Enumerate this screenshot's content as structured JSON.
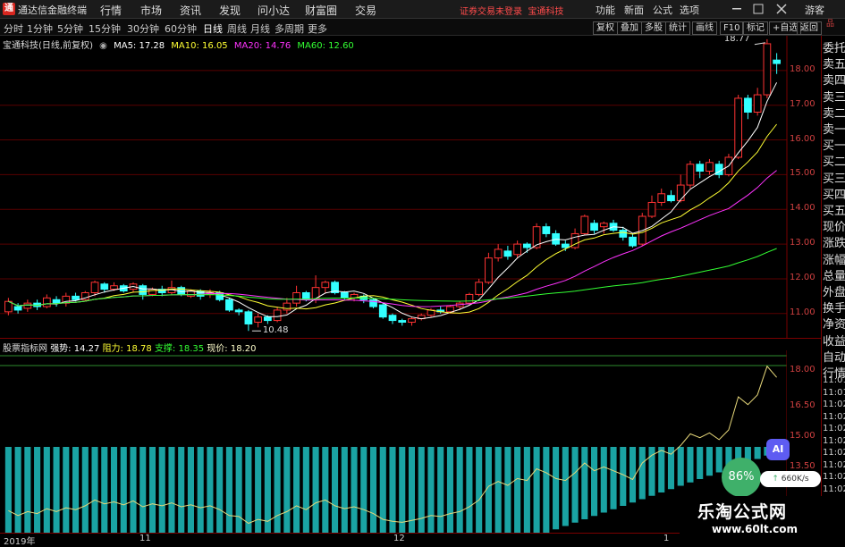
{
  "app": {
    "title": "通达信金融终端",
    "logo_char": "通"
  },
  "menu": [
    "行情",
    "市场",
    "资讯",
    "发现",
    "问小达",
    "财富圈",
    "交易"
  ],
  "notice": "证券交易未登录",
  "stock_name": "宝通科技",
  "right_menu": [
    "功能",
    "新面",
    "公式",
    "选项"
  ],
  "guest": "游客",
  "periods": [
    "分时",
    "1分钟",
    "5分钟",
    "15分钟",
    "30分钟",
    "60分钟",
    "日线",
    "周线",
    "月线",
    "多周期",
    "更多"
  ],
  "active_period": "日线",
  "toolbar_buttons": [
    "复权",
    "叠加",
    "多股",
    "统计",
    "画线",
    "F10",
    "标记",
    "+自选",
    "返回"
  ],
  "info": {
    "title": "宝通科技(日线,前复权)",
    "ma5": "MA5: 17.28",
    "ma10": "MA10: 16.05",
    "ma20": "MA20: 14.76",
    "ma60": "MA60: 12.60"
  },
  "colors": {
    "ma5": "#ffffff",
    "ma10": "#ffff33",
    "ma20": "#ff33ff",
    "ma60": "#33ff33",
    "up": "#ff3333",
    "down": "#33ffff",
    "background": "#000000"
  },
  "price_axis": [
    "18.00",
    "17.00",
    "16.00",
    "15.00",
    "14.00",
    "13.00",
    "12.00",
    "11.00"
  ],
  "annotations": {
    "high": "18.77",
    "low": "10.48"
  },
  "right_panel": [
    "委托",
    "卖五",
    "卖四",
    "卖三",
    "卖二",
    "卖一",
    "买一",
    "买二",
    "买三",
    "买四",
    "买五",
    "现价",
    "涨跌",
    "涨幅",
    "总量",
    "外盘",
    "换手",
    "净资",
    "收益",
    "自动",
    "行情"
  ],
  "right_panel_top": "品",
  "sub_indicator": {
    "name": "股票指标网",
    "pressure": "强势: 14.27",
    "resistance": "阻力: 18.78",
    "support": "支撑: 18.35",
    "price": "现价: 18.20"
  },
  "sub_axis": [
    "18.00",
    "16.50",
    "15.00",
    "13.50"
  ],
  "time_labels": [
    "11:01",
    "11:01",
    "11:02",
    "11:02",
    "11:02",
    "11:02",
    "11:02",
    "11:02",
    "11:02",
    "11:02",
    "11:02"
  ],
  "date_axis": [
    "2019年",
    "11",
    "12",
    "1"
  ],
  "perf": "86%",
  "net_speed": "660K/s",
  "ai_label": "AI",
  "watermark": {
    "line1": "乐淘公式网",
    "line2": "www.60lt.com"
  },
  "chart_data": {
    "type": "candlestick",
    "ylim": [
      10.3,
      19.0
    ],
    "candles": [
      [
        11.05,
        11.35,
        11.45,
        10.95
      ],
      [
        11.2,
        11.1,
        11.3,
        11.0
      ],
      [
        11.15,
        11.3,
        11.4,
        11.05
      ],
      [
        11.3,
        11.2,
        11.4,
        11.1
      ],
      [
        11.2,
        11.45,
        11.55,
        11.15
      ],
      [
        11.4,
        11.3,
        11.5,
        11.2
      ],
      [
        11.3,
        11.5,
        11.6,
        11.2
      ],
      [
        11.5,
        11.4,
        11.6,
        11.35
      ],
      [
        11.4,
        11.6,
        11.65,
        11.35
      ],
      [
        11.6,
        11.9,
        11.95,
        11.5
      ],
      [
        11.85,
        11.7,
        11.9,
        11.6
      ],
      [
        11.7,
        11.8,
        11.9,
        11.65
      ],
      [
        11.8,
        11.65,
        11.85,
        11.6
      ],
      [
        11.7,
        11.85,
        11.9,
        11.6
      ],
      [
        11.8,
        11.55,
        11.85,
        11.4
      ],
      [
        11.55,
        11.7,
        11.75,
        11.5
      ],
      [
        11.7,
        11.6,
        11.8,
        11.5
      ],
      [
        11.6,
        11.75,
        11.95,
        11.55
      ],
      [
        11.75,
        11.55,
        11.8,
        11.5
      ],
      [
        11.5,
        11.65,
        11.7,
        11.45
      ],
      [
        11.65,
        11.5,
        11.7,
        11.4
      ],
      [
        11.55,
        11.6,
        11.7,
        11.45
      ],
      [
        11.6,
        11.4,
        11.65,
        11.35
      ],
      [
        11.4,
        11.1,
        11.45,
        11.05
      ],
      [
        11.1,
        11.05,
        11.15,
        10.95
      ],
      [
        11.05,
        10.7,
        11.1,
        10.5
      ],
      [
        10.75,
        10.9,
        11.0,
        10.6
      ],
      [
        10.9,
        10.8,
        10.95,
        10.7
      ],
      [
        10.8,
        11.1,
        11.2,
        10.75
      ],
      [
        11.1,
        11.3,
        11.45,
        11.0
      ],
      [
        11.3,
        11.6,
        11.8,
        11.2
      ],
      [
        11.6,
        11.4,
        11.65,
        11.35
      ],
      [
        11.4,
        11.75,
        12.1,
        11.3
      ],
      [
        11.75,
        11.9,
        11.95,
        11.6
      ],
      [
        11.9,
        11.6,
        11.95,
        11.55
      ],
      [
        11.6,
        11.45,
        11.65,
        11.4
      ],
      [
        11.45,
        11.55,
        11.6,
        11.35
      ],
      [
        11.5,
        11.4,
        11.55,
        11.3
      ],
      [
        11.4,
        11.2,
        11.45,
        11.15
      ],
      [
        11.25,
        10.9,
        11.3,
        10.85
      ],
      [
        10.95,
        10.8,
        11.0,
        10.7
      ],
      [
        10.8,
        10.75,
        10.85,
        10.65
      ],
      [
        10.75,
        10.85,
        10.9,
        10.65
      ],
      [
        10.85,
        10.95,
        11.0,
        10.8
      ],
      [
        10.95,
        11.1,
        11.15,
        10.9
      ],
      [
        11.1,
        11.05,
        11.2,
        11.0
      ],
      [
        11.05,
        11.2,
        11.25,
        11.0
      ],
      [
        11.2,
        11.3,
        11.35,
        11.1
      ],
      [
        11.3,
        11.55,
        11.6,
        11.25
      ],
      [
        11.55,
        11.9,
        12.0,
        11.5
      ],
      [
        11.9,
        12.6,
        12.75,
        11.85
      ],
      [
        12.6,
        12.85,
        13.0,
        12.5
      ],
      [
        12.8,
        12.65,
        12.95,
        12.55
      ],
      [
        12.7,
        13.0,
        13.1,
        12.6
      ],
      [
        13.0,
        12.9,
        13.05,
        12.75
      ],
      [
        12.9,
        13.5,
        13.6,
        12.85
      ],
      [
        13.5,
        13.3,
        13.6,
        13.2
      ],
      [
        13.3,
        13.0,
        13.4,
        12.95
      ],
      [
        13.0,
        12.9,
        13.1,
        12.8
      ],
      [
        12.9,
        13.3,
        13.45,
        12.85
      ],
      [
        13.3,
        13.8,
        13.85,
        13.25
      ],
      [
        13.6,
        13.4,
        13.7,
        13.3
      ],
      [
        13.5,
        13.6,
        13.65,
        13.3
      ],
      [
        13.6,
        13.4,
        13.7,
        13.35
      ],
      [
        13.4,
        13.2,
        13.5,
        13.1
      ],
      [
        13.2,
        12.95,
        13.3,
        12.9
      ],
      [
        13.0,
        13.8,
        13.9,
        12.95
      ],
      [
        13.8,
        14.2,
        14.4,
        13.75
      ],
      [
        14.2,
        14.45,
        14.6,
        14.1
      ],
      [
        14.4,
        14.25,
        14.55,
        14.2
      ],
      [
        14.25,
        14.7,
        15.0,
        14.2
      ],
      [
        14.7,
        15.3,
        15.4,
        14.6
      ],
      [
        15.3,
        15.1,
        15.4,
        14.9
      ],
      [
        15.1,
        15.35,
        15.45,
        15.0
      ],
      [
        15.3,
        15.0,
        15.4,
        14.9
      ],
      [
        15.0,
        15.5,
        15.6,
        14.95
      ],
      [
        15.5,
        17.2,
        17.3,
        15.45
      ],
      [
        17.2,
        16.8,
        17.3,
        16.6
      ],
      [
        16.8,
        17.3,
        17.5,
        16.7
      ],
      [
        17.3,
        18.77,
        18.9,
        17.2
      ],
      [
        18.3,
        18.2,
        18.5,
        17.9
      ]
    ],
    "ma": {
      "ma5": [],
      "ma10": [],
      "ma20": [],
      "ma60": []
    }
  }
}
